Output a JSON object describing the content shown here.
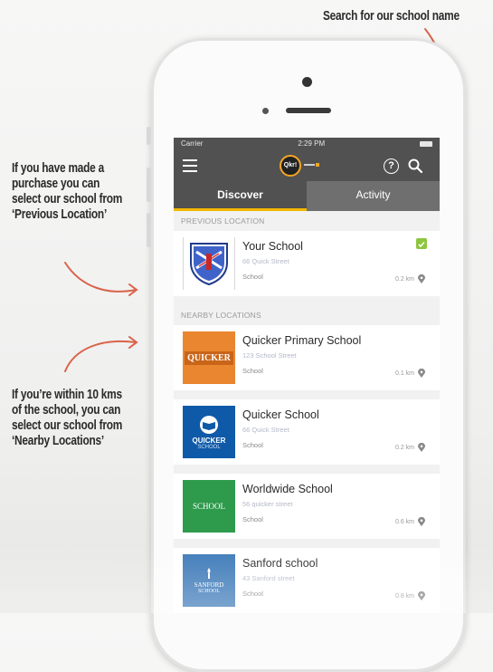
{
  "annotations": {
    "top": "Search for our school name",
    "left1": "If you have made a purchase you can select our school from ‘Previous Location’",
    "left2": "If you’re within 10 kms of the school, you can select our school from ‘Nearby Locations’"
  },
  "status_bar": {
    "carrier": "Carrier",
    "time": "2:29 PM"
  },
  "header": {
    "logo_text": "Qkr!",
    "icons": [
      "menu-icon",
      "help-icon",
      "search-icon"
    ]
  },
  "tabs": [
    {
      "label": "Discover",
      "active": true
    },
    {
      "label": "Activity",
      "active": false
    }
  ],
  "previous_location": {
    "header": "PREVIOUS LOCATION",
    "item": {
      "name": "Your School",
      "address": "66 Quick Street",
      "type": "School",
      "distance": "0.2 km",
      "selected": true
    }
  },
  "nearby_locations": {
    "header": "NEARBY LOCATIONS",
    "items": [
      {
        "name": "Quicker Primary School",
        "address": "123 School Street",
        "type": "School",
        "distance": "0.1 km",
        "logo_text": "QUICKER",
        "logo_color": "#e9862f"
      },
      {
        "name": "Quicker School",
        "address": "66 Quick Street",
        "type": "School",
        "distance": "0.2 km",
        "logo_text": "QUICKER",
        "logo_sub": "SCHOOL",
        "logo_color": "#0f5aa8"
      },
      {
        "name": "Worldwide School",
        "address": "56 quicker street",
        "type": "School",
        "distance": "0.6 km",
        "logo_text": "SCHOOL",
        "logo_color": "#2e9a4c"
      },
      {
        "name": "Sanford school",
        "address": "43 Sanford street",
        "type": "School",
        "distance": "0.8 km",
        "logo_text": "SANFORD",
        "logo_sub": "SCHOOL",
        "logo_color": "#3c79b8"
      }
    ]
  },
  "colors": {
    "navbar": "#515151",
    "tab_indicator": "#f5b800",
    "check": "#8cc63f",
    "arrow": "#d9634a"
  }
}
